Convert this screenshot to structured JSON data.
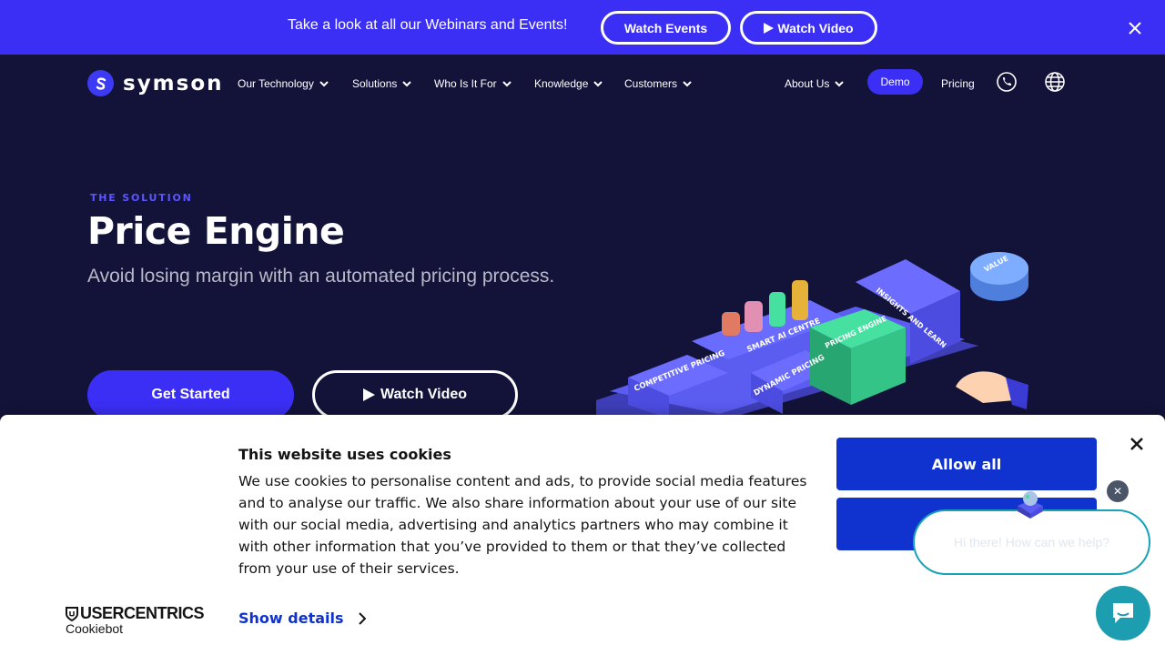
{
  "banner": {
    "text": "Take a look at all our Webinars and Events!",
    "events_label": "Watch Events",
    "video_label": "Watch Video"
  },
  "nav": {
    "logo_text": "symson",
    "items": [
      {
        "label": "Our Technology"
      },
      {
        "label": "Solutions"
      },
      {
        "label": "Who Is It For"
      },
      {
        "label": "Knowledge"
      },
      {
        "label": "Customers"
      },
      {
        "label": "About Us"
      }
    ],
    "demo_label": "Demo",
    "pricing_label": "Pricing",
    "icons": [
      "phone-icon",
      "globe-icon"
    ]
  },
  "hero": {
    "eyebrow": "THE SOLUTION",
    "title": "Price Engine",
    "subtitle": "Avoid losing margin with an automated pricing process.",
    "primary_cta": "Get Started",
    "secondary_cta": "Watch Video",
    "illustration_labels": [
      "COMPETITIVE PRICING",
      "SMART AI CENTRE",
      "DYNAMIC PRICING",
      "PRICING ENGINE",
      "INSIGHTS AND LEARN",
      "VALUE"
    ]
  },
  "cookie": {
    "title": "This website uses cookies",
    "body": "We use cookies to personalise content and ads, to provide social media features and to analyse our traffic. We also share information about your use of our site with our social media, advertising and analytics partners who may combine it with other information that you’ve provided to them or that they’ve collected from your use of their services.",
    "brand": "USERCENTRICS",
    "brand_sub": "Cookiebot",
    "show_details": "Show details",
    "allow_all": "Allow all"
  },
  "chat": {
    "message": "Hi there! How can we help?"
  },
  "colors": {
    "brand": "#3b2ff5",
    "background": "#13133a",
    "cookie_button": "#1032cf",
    "chat_accent": "#1d9db0"
  }
}
